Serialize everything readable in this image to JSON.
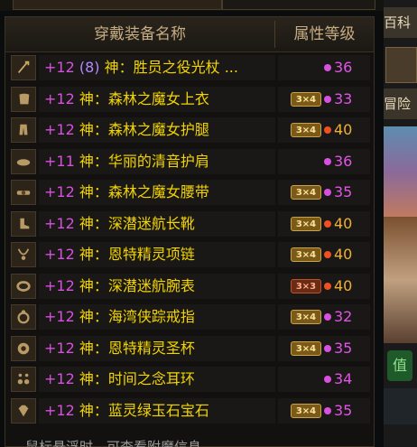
{
  "header": {
    "name_col": "穿戴装备名称",
    "attr_col": "属性等级"
  },
  "right_panel": {
    "label_1": "百科",
    "label_2": "冒险",
    "tag": "值"
  },
  "footer_tip": "鼠标悬浮时，可查看附魔信息",
  "items": [
    {
      "slot": "weapon-icon",
      "level": "+12",
      "extra": "(8)",
      "name": "神：胜员之役光杖 ...",
      "badge": "",
      "badge_style": "",
      "dot": "#d94fe0",
      "attr_level": "36",
      "attr_color": "pink"
    },
    {
      "slot": "coat-icon",
      "level": "+12",
      "extra": "",
      "name": "神：森林之魔女上衣",
      "badge": "3×4",
      "badge_style": "gold",
      "dot": "#d94fe0",
      "attr_level": "33",
      "attr_color": "pink"
    },
    {
      "slot": "pants-icon",
      "level": "+12",
      "extra": "",
      "name": "神：森林之魔女护腿",
      "badge": "3×4",
      "badge_style": "gold",
      "dot": "#f05020",
      "attr_level": "40",
      "attr_color": "orange"
    },
    {
      "slot": "shoulder-icon",
      "level": "+11",
      "extra": "",
      "name": "神：华丽的清音护肩",
      "badge": "",
      "badge_style": "",
      "dot": "#d94fe0",
      "attr_level": "36",
      "attr_color": "pink"
    },
    {
      "slot": "belt-icon",
      "level": "+12",
      "extra": "",
      "name": "神：森林之魔女腰带",
      "badge": "3×4",
      "badge_style": "gold",
      "dot": "#d94fe0",
      "attr_level": "35",
      "attr_color": "pink"
    },
    {
      "slot": "boots-icon",
      "level": "+12",
      "extra": "",
      "name": "神：深潜迷航长靴",
      "badge": "3×4",
      "badge_style": "gold",
      "dot": "#f05020",
      "attr_level": "40",
      "attr_color": "orange"
    },
    {
      "slot": "necklace-icon",
      "level": "+12",
      "extra": "",
      "name": "神：恩特精灵项链",
      "badge": "3×4",
      "badge_style": "gold",
      "dot": "#f05020",
      "attr_level": "40",
      "attr_color": "orange"
    },
    {
      "slot": "bracelet-icon",
      "level": "+12",
      "extra": "",
      "name": "神：深潜迷航腕表",
      "badge": "3×3",
      "badge_style": "red",
      "dot": "#f05020",
      "attr_level": "40",
      "attr_color": "orange"
    },
    {
      "slot": "ring-icon",
      "level": "+12",
      "extra": "",
      "name": "神：海湾侠踪戒指",
      "badge": "3×4",
      "badge_style": "gold",
      "dot": "#d94fe0",
      "attr_level": "32",
      "attr_color": "pink"
    },
    {
      "slot": "support-icon",
      "level": "+12",
      "extra": "",
      "name": "神：恩特精灵圣杯",
      "badge": "3×4",
      "badge_style": "gold",
      "dot": "#d94fe0",
      "attr_level": "35",
      "attr_color": "pink"
    },
    {
      "slot": "earring-icon",
      "level": "+12",
      "extra": "",
      "name": "神：时间之念耳环",
      "badge": "",
      "badge_style": "",
      "dot": "#d94fe0",
      "attr_level": "34",
      "attr_color": "pink"
    },
    {
      "slot": "gem-icon",
      "level": "+12",
      "extra": "",
      "name": "神：蓝灵绿玉石宝石",
      "badge": "3×4",
      "badge_style": "gold",
      "dot": "#d94fe0",
      "attr_level": "35",
      "attr_color": "pink"
    }
  ]
}
